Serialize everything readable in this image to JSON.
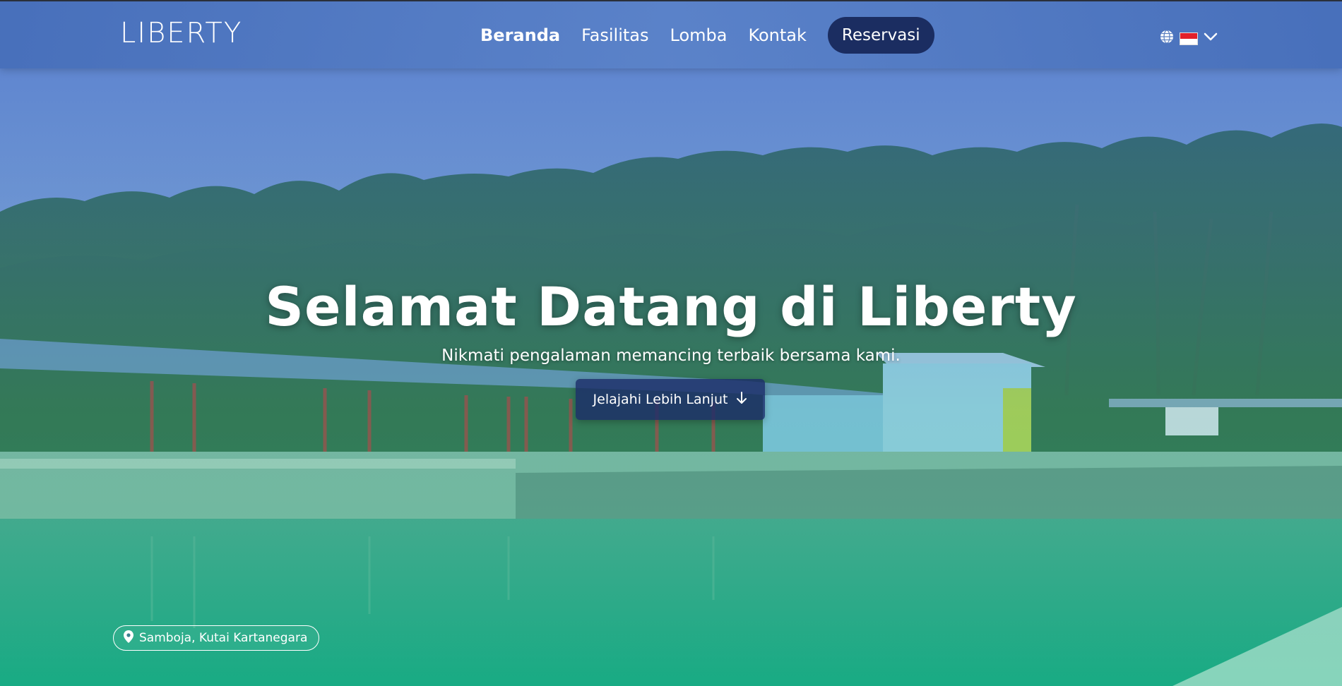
{
  "brand": {
    "logo_text": "LIBERTY"
  },
  "nav": {
    "items": [
      {
        "label": "Beranda",
        "active": true
      },
      {
        "label": "Fasilitas",
        "active": false
      },
      {
        "label": "Lomba",
        "active": false
      },
      {
        "label": "Kontak",
        "active": false
      }
    ],
    "reserve_label": "Reservasi",
    "language": {
      "icon": "globe-icon",
      "flag": "indonesia-flag",
      "chevron": "chevron-down-icon"
    }
  },
  "hero": {
    "title": "Selamat Datang di Liberty",
    "subtitle": "Nikmati pengalaman memancing terbaik bersama kami.",
    "cta_label": "Jelajahi Lebih Lanjut",
    "cta_icon": "arrow-down-icon"
  },
  "location": {
    "icon": "map-pin-icon",
    "label": "Samboja, Kutai Kartanegara"
  },
  "colors": {
    "nav_bg": "#5a7fc0",
    "reserve_bg": "#1b2d61",
    "cta_bg": "#1c2d69",
    "flag_red": "#e2202a",
    "flag_white": "#ffffff"
  }
}
